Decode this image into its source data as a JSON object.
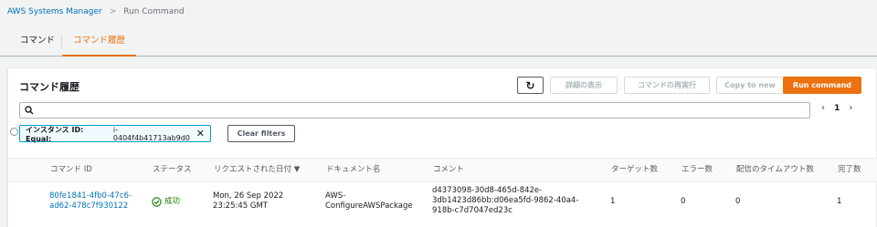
{
  "breadcrumb": {
    "root": "AWS Systems Manager",
    "separator": ">",
    "current": "Run Command"
  },
  "tabs": [
    {
      "label": "コマンド"
    },
    {
      "label": "コマンド履歴"
    }
  ],
  "panel": {
    "title": "コマンド履歴",
    "buttons": {
      "refresh": "↻",
      "details": "詳細の表示",
      "rerun": "コマンドの再実行",
      "copy": "Copy to new",
      "run": "Run command"
    }
  },
  "filter": {
    "token_key": "インスタンス ID: Equal:",
    "token_value": "i-0404f4b41713ab9d0",
    "clear_label": "Clear filters"
  },
  "pagination": {
    "prev": "‹",
    "page": "1",
    "next": "›"
  },
  "table": {
    "columns": {
      "command_id": "コマンド ID",
      "status": "ステータス",
      "requested": "リクエストされた日付 ▼",
      "document": "ドキュメント名",
      "comment": "コメント",
      "targets": "ターゲット数",
      "errors": "エラー数",
      "timeouts": "配信のタイムアウト数",
      "complete": "完了数"
    },
    "rows": [
      {
        "command_id_l1": "80fe1841-4fb0-47c6-",
        "command_id_l2": "ad62-478c7f930122",
        "status": "成功",
        "date_l1": "Mon, 26 Sep 2022",
        "date_l2": "23:25:45 GMT",
        "doc_l1": "AWS-",
        "doc_l2": "ConfigureAWSPackage",
        "comment_l1": "d4373098-30d8-465d-842e-",
        "comment_l2": "3db1423d86bb:d06ea5fd-9862-40a4-",
        "comment_l3": "918b-c7d7047ed23c",
        "targets": "1",
        "errors": "0",
        "timeouts": "0",
        "complete": "1"
      }
    ]
  }
}
